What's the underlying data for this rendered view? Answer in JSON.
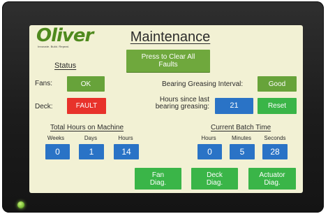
{
  "logo": {
    "brand": "Oliver",
    "tagline": "Innovate. Build. Repeat."
  },
  "page_title": "Maintenance",
  "clear_faults": {
    "label": "Press to Clear All Faults"
  },
  "status": {
    "heading": "Status",
    "fans": {
      "label": "Fans:",
      "value": "OK"
    },
    "deck": {
      "label": "Deck:",
      "value": "FAULT"
    }
  },
  "bearing": {
    "interval_label": "Bearing Greasing Interval:",
    "interval_value": "Good",
    "hours_label_line1": "Hours since last",
    "hours_label_line2": "bearing greasing:",
    "hours_value": "21",
    "reset_label": "Reset"
  },
  "total_hours": {
    "heading": "Total Hours on Machine",
    "columns": [
      {
        "label": "Weeks",
        "value": "0"
      },
      {
        "label": "Days",
        "value": "1"
      },
      {
        "label": "Hours",
        "value": "14"
      }
    ]
  },
  "batch_time": {
    "heading": "Current Batch Time",
    "columns": [
      {
        "label": "Hours",
        "value": "0"
      },
      {
        "label": "Minutes",
        "value": "5"
      },
      {
        "label": "Seconds",
        "value": "28"
      }
    ]
  },
  "diagnostics": [
    {
      "line1": "Fan",
      "line2": "Diag."
    },
    {
      "line1": "Deck",
      "line2": "Diag."
    },
    {
      "line1": "Actuator",
      "line2": "Diag."
    }
  ],
  "colors": {
    "screen_bg": "#f2f1d4",
    "status_ok": "#67a33a",
    "status_fault": "#e8322b",
    "value_blue": "#2a73c6",
    "action_green": "#3ab548",
    "brand_green": "#4f8a1e"
  }
}
